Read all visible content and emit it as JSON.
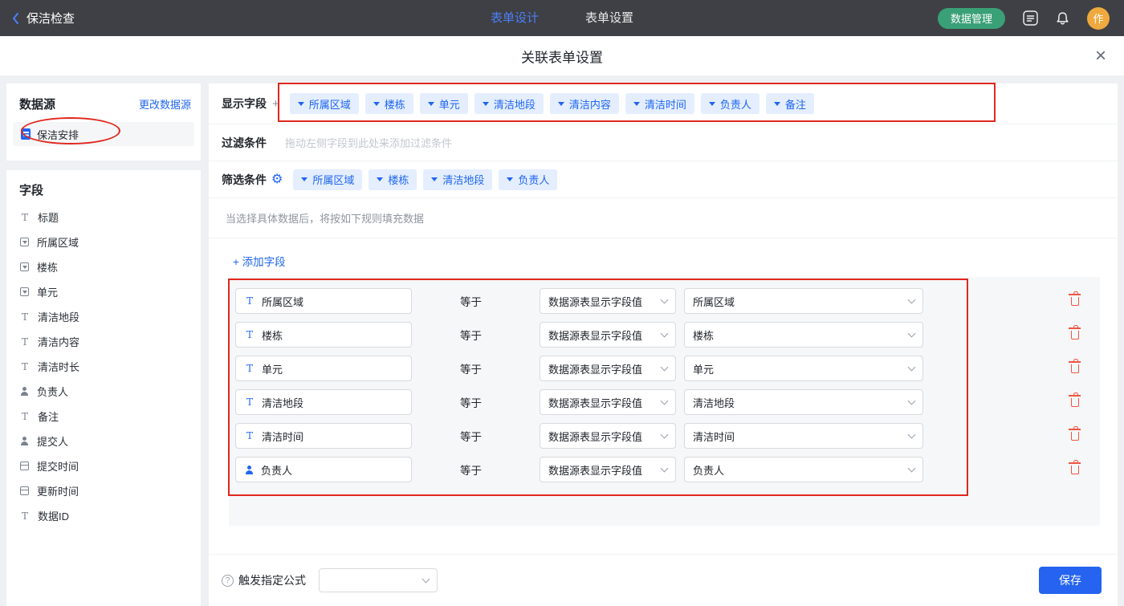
{
  "topbar": {
    "back_label": "保洁检查",
    "tabs": [
      {
        "label": "表单设计",
        "active": true
      },
      {
        "label": "表单设置",
        "active": false
      }
    ],
    "data_manage_label": "数据管理",
    "avatar_text": "作",
    "icons": {
      "back": "chevron-left",
      "app": "app-panel",
      "bell": "notification-bell"
    }
  },
  "modal": {
    "title": "关联表单设置",
    "close_glyph": "×"
  },
  "sidebar": {
    "datasource_title": "数据源",
    "change_datasource_label": "更改数据源",
    "datasource_item": {
      "label": "保洁安排",
      "icon": "document"
    },
    "fields_title": "字段",
    "fields": [
      {
        "label": "标题",
        "icon": "text"
      },
      {
        "label": "所属区域",
        "icon": "select"
      },
      {
        "label": "楼栋",
        "icon": "select"
      },
      {
        "label": "单元",
        "icon": "select"
      },
      {
        "label": "清洁地段",
        "icon": "text"
      },
      {
        "label": "清洁内容",
        "icon": "text"
      },
      {
        "label": "清洁时长",
        "icon": "text"
      },
      {
        "label": "负责人",
        "icon": "person"
      },
      {
        "label": "备注",
        "icon": "text"
      },
      {
        "label": "提交人",
        "icon": "person"
      },
      {
        "label": "提交时间",
        "icon": "date"
      },
      {
        "label": "更新时间",
        "icon": "date"
      },
      {
        "label": "数据ID",
        "icon": "text"
      }
    ]
  },
  "main": {
    "display_fields": {
      "label": "显示字段",
      "add_glyph": "+",
      "tags": [
        "所属区域",
        "楼栋",
        "单元",
        "清洁地段",
        "清洁内容",
        "清洁时间",
        "负责人",
        "备注"
      ]
    },
    "filter": {
      "label": "过滤条件",
      "placeholder": "拖动左侧字段到此处来添加过滤条件"
    },
    "screen": {
      "label": "筛选条件",
      "tags": [
        "所属区域",
        "楼栋",
        "清洁地段",
        "负责人"
      ]
    },
    "hint": "当选择具体数据后，将按如下规则填充数据",
    "add_field_label": "+ 添加字段",
    "equals_label": "等于",
    "rules": [
      {
        "field": "所属区域",
        "icon": "text",
        "source": "数据源表显示字段值",
        "value": "所属区域"
      },
      {
        "field": "楼栋",
        "icon": "text",
        "source": "数据源表显示字段值",
        "value": "楼栋"
      },
      {
        "field": "单元",
        "icon": "text",
        "source": "数据源表显示字段值",
        "value": "单元"
      },
      {
        "field": "清洁地段",
        "icon": "text",
        "source": "数据源表显示字段值",
        "value": "清洁地段"
      },
      {
        "field": "清洁时间",
        "icon": "text",
        "source": "数据源表显示字段值",
        "value": "清洁时间"
      },
      {
        "field": "负责人",
        "icon": "person",
        "source": "数据源表显示字段值",
        "value": "负责人"
      }
    ],
    "footer": {
      "help_glyph": "?",
      "formula_label": "触发指定公式",
      "formula_value": "",
      "save_label": "保存"
    }
  },
  "colors": {
    "accent_blue": "#2166f3",
    "tag_bg": "#e4eeff",
    "green_button": "#3aa077",
    "annotation_red": "#e0281e",
    "trash_red": "#f25643",
    "topbar_bg": "#3e4045"
  }
}
